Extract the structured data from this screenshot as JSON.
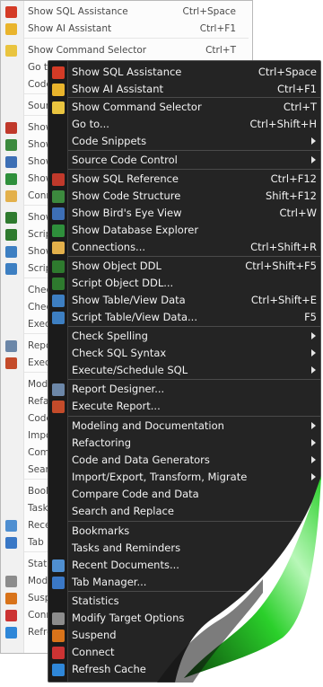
{
  "back_menu": {
    "items": [
      {
        "label": "Show SQL Assistance",
        "shortcut": "Ctrl+Space",
        "icon": "magic-wand-icon"
      },
      {
        "label": "Show AI Assistant",
        "shortcut": "Ctrl+F1",
        "icon": "sparkle-icon"
      },
      {
        "label": "Show Command Selector",
        "shortcut": "Ctrl+T",
        "icon": "lightning-icon"
      },
      {
        "label": "Go to",
        "shortcut": "",
        "icon": ""
      },
      {
        "label": "Code",
        "shortcut": "",
        "icon": ""
      },
      {
        "label": "Sour",
        "shortcut": "",
        "icon": ""
      },
      {
        "label": "Show",
        "shortcut": "",
        "icon": "sql-reference-icon"
      },
      {
        "label": "Show",
        "shortcut": "",
        "icon": "code-structure-icon"
      },
      {
        "label": "Show",
        "shortcut": "",
        "icon": "birds-eye-icon"
      },
      {
        "label": "Show",
        "shortcut": "",
        "icon": "database-explorer-icon"
      },
      {
        "label": "Conn",
        "shortcut": "",
        "icon": "connections-icon"
      },
      {
        "label": "Show",
        "shortcut": "",
        "icon": "object-ddl-icon"
      },
      {
        "label": "Scrip",
        "shortcut": "",
        "icon": "script-ddl-icon"
      },
      {
        "label": "Show",
        "shortcut": "",
        "icon": "table-data-icon"
      },
      {
        "label": "Scrip",
        "shortcut": "",
        "icon": "script-table-icon"
      },
      {
        "label": "Chec",
        "shortcut": "",
        "icon": ""
      },
      {
        "label": "Chec",
        "shortcut": "",
        "icon": ""
      },
      {
        "label": "Exec",
        "shortcut": "",
        "icon": ""
      },
      {
        "label": "Repo",
        "shortcut": "",
        "icon": "report-designer-icon"
      },
      {
        "label": "Exec",
        "shortcut": "",
        "icon": "execute-report-icon"
      },
      {
        "label": "Mod",
        "shortcut": "",
        "icon": ""
      },
      {
        "label": "Refa",
        "shortcut": "",
        "icon": ""
      },
      {
        "label": "Code",
        "shortcut": "",
        "icon": ""
      },
      {
        "label": "Impo",
        "shortcut": "",
        "icon": ""
      },
      {
        "label": "Com",
        "shortcut": "",
        "icon": ""
      },
      {
        "label": "Searc",
        "shortcut": "",
        "icon": ""
      },
      {
        "label": "Book",
        "shortcut": "",
        "icon": ""
      },
      {
        "label": "Tasks",
        "shortcut": "",
        "icon": ""
      },
      {
        "label": "Rece",
        "shortcut": "",
        "icon": "recent-documents-icon"
      },
      {
        "label": "Tab M",
        "shortcut": "",
        "icon": "tab-manager-icon"
      },
      {
        "label": "Statis",
        "shortcut": "",
        "icon": ""
      },
      {
        "label": "Modi",
        "shortcut": "",
        "icon": "tools-icon"
      },
      {
        "label": "Susp",
        "shortcut": "",
        "icon": "suspend-icon"
      },
      {
        "label": "Conn",
        "shortcut": "",
        "icon": "connect-icon"
      },
      {
        "label": "Refre",
        "shortcut": "",
        "icon": "refresh-icon"
      }
    ]
  },
  "front_menu": {
    "items": [
      {
        "label": "Show SQL Assistance",
        "shortcut": "Ctrl+Space",
        "icon": "magic-wand-icon",
        "submenu": false
      },
      {
        "label": "Show AI Assistant",
        "shortcut": "Ctrl+F1",
        "icon": "sparkle-icon",
        "submenu": false
      },
      {
        "label": "Show Command Selector",
        "shortcut": "Ctrl+T",
        "icon": "lightning-icon",
        "submenu": false
      },
      {
        "label": "Go to...",
        "shortcut": "Ctrl+Shift+H",
        "icon": "",
        "submenu": false
      },
      {
        "label": "Code Snippets",
        "shortcut": "",
        "icon": "",
        "submenu": true
      },
      {
        "label": "Source Code Control",
        "shortcut": "",
        "icon": "",
        "submenu": true
      },
      {
        "label": "Show SQL Reference",
        "shortcut": "Ctrl+F12",
        "icon": "sql-reference-icon",
        "submenu": false
      },
      {
        "label": "Show Code Structure",
        "shortcut": "Shift+F12",
        "icon": "code-structure-icon",
        "submenu": false
      },
      {
        "label": "Show Bird's Eye View",
        "shortcut": "Ctrl+W",
        "icon": "birds-eye-icon",
        "submenu": false
      },
      {
        "label": "Show Database Explorer",
        "shortcut": "",
        "icon": "database-explorer-icon",
        "submenu": false
      },
      {
        "label": "Connections...",
        "shortcut": "Ctrl+Shift+R",
        "icon": "connections-icon",
        "submenu": false
      },
      {
        "label": "Show Object DDL",
        "shortcut": "Ctrl+Shift+F5",
        "icon": "object-ddl-icon",
        "submenu": false
      },
      {
        "label": "Script Object DDL...",
        "shortcut": "",
        "icon": "script-ddl-icon",
        "submenu": false
      },
      {
        "label": "Show Table/View Data",
        "shortcut": "Ctrl+Shift+E",
        "icon": "table-data-icon",
        "submenu": false
      },
      {
        "label": "Script Table/View Data...",
        "shortcut": "F5",
        "icon": "script-table-icon",
        "submenu": false
      },
      {
        "label": "Check Spelling",
        "shortcut": "",
        "icon": "",
        "submenu": true
      },
      {
        "label": "Check SQL Syntax",
        "shortcut": "",
        "icon": "",
        "submenu": true
      },
      {
        "label": "Execute/Schedule SQL",
        "shortcut": "",
        "icon": "",
        "submenu": true
      },
      {
        "label": "Report Designer...",
        "shortcut": "",
        "icon": "report-designer-icon",
        "submenu": false
      },
      {
        "label": "Execute Report...",
        "shortcut": "",
        "icon": "execute-report-icon",
        "submenu": false
      },
      {
        "label": "Modeling and Documentation",
        "shortcut": "",
        "icon": "",
        "submenu": true
      },
      {
        "label": "Refactoring",
        "shortcut": "",
        "icon": "",
        "submenu": true
      },
      {
        "label": "Code and Data Generators",
        "shortcut": "",
        "icon": "",
        "submenu": true
      },
      {
        "label": "Import/Export, Transform, Migrate",
        "shortcut": "",
        "icon": "",
        "submenu": true
      },
      {
        "label": "Compare Code and Data",
        "shortcut": "",
        "icon": "",
        "submenu": false
      },
      {
        "label": "Search and Replace",
        "shortcut": "",
        "icon": "",
        "submenu": false
      },
      {
        "label": "Bookmarks",
        "shortcut": "",
        "icon": "",
        "submenu": false
      },
      {
        "label": "Tasks and Reminders",
        "shortcut": "",
        "icon": "",
        "submenu": false
      },
      {
        "label": "Recent Documents...",
        "shortcut": "",
        "icon": "recent-documents-icon",
        "submenu": false
      },
      {
        "label": "Tab Manager...",
        "shortcut": "",
        "icon": "tab-manager-icon",
        "submenu": false
      },
      {
        "label": "Statistics",
        "shortcut": "",
        "icon": "",
        "submenu": false
      },
      {
        "label": "Modify Target Options",
        "shortcut": "",
        "icon": "tools-icon",
        "submenu": false
      },
      {
        "label": "Suspend",
        "shortcut": "",
        "icon": "suspend-icon",
        "submenu": false
      },
      {
        "label": "Connect",
        "shortcut": "",
        "icon": "connect-icon",
        "submenu": false
      },
      {
        "label": "Refresh Cache",
        "shortcut": "",
        "icon": "refresh-icon",
        "submenu": false
      }
    ]
  },
  "colors": {
    "dark_menu_bg": "#242424",
    "light_menu_bg": "#fcfcfc",
    "curl_green": "#2bd02b"
  }
}
